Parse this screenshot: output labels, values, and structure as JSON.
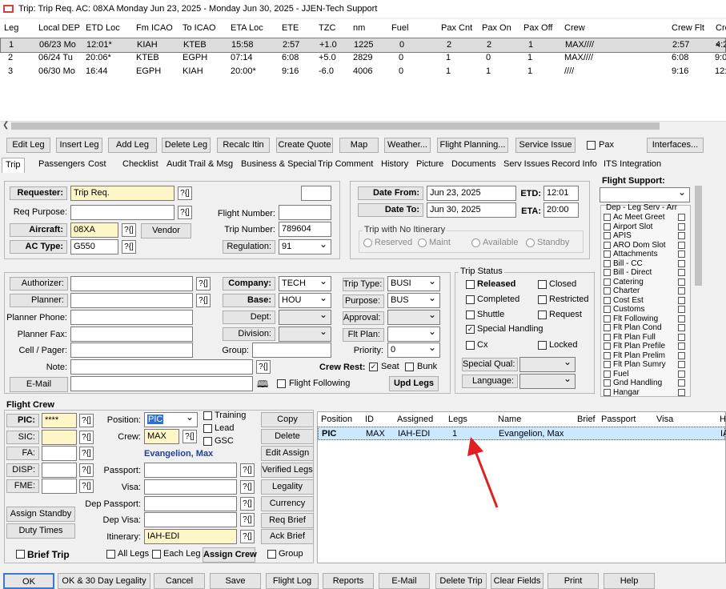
{
  "window": {
    "title": "Trip: Trip Req.  AC: 08XA  Monday Jun 23, 2025 - Monday Jun 30, 2025 - JJEN-Tech Support"
  },
  "legs": {
    "headers": [
      "Leg",
      "Local DEP",
      "ETD Loc",
      "Fm ICAO",
      "To ICAO",
      "ETA Loc",
      "ETE",
      "TZC",
      "nm",
      "Fuel",
      "Pax Cnt",
      "Pax On",
      "Pax Off",
      "Crew",
      "Crew Flt",
      "Cre"
    ],
    "rows": [
      [
        "1",
        "06/23 Mo",
        "12:01*",
        "KIAH",
        "KTEB",
        "15:58",
        "2:57",
        "+1.0",
        "1225",
        "0",
        "2",
        "2",
        "1",
        "MAX////",
        "2:57",
        "4:2"
      ],
      [
        "2",
        "06/24 Tu",
        "20:06*",
        "KTEB",
        "EGPH",
        "07:14",
        "6:08",
        "+5.0",
        "2829",
        "0",
        "1",
        "0",
        "1",
        "MAX////",
        "6:08",
        "9:0"
      ],
      [
        "3",
        "06/30 Mo",
        "16:44",
        "EGPH",
        "KIAH",
        "20:00*",
        "9:16",
        "-6.0",
        "4006",
        "0",
        "1",
        "1",
        "1",
        "////",
        "9:16",
        "12:"
      ]
    ]
  },
  "toolbar": {
    "edit_leg": "Edit Leg",
    "insert_leg": "Insert Leg",
    "add_leg": "Add Leg",
    "delete_leg": "Delete Leg",
    "recalc": "Recalc Itin",
    "create_quote": "Create Quote",
    "map": "Map",
    "weather": "Weather...",
    "flight_planning": "Flight Planning...",
    "service_issue": "Service Issue",
    "pax": "Pax",
    "interfaces": "Interfaces..."
  },
  "tabs": [
    "Trip",
    "Passengers",
    "Cost",
    "Checklist",
    "Audit Trail & Msg",
    "Business & Special",
    "Trip Comment",
    "History",
    "Picture",
    "Documents",
    "Serv Issues",
    "Record Info",
    "ITS Integration"
  ],
  "trip": {
    "requester_label": "Requester:",
    "requester": "Trip Req.",
    "req_purpose_label": "Req Purpose:",
    "req_purpose": "",
    "aircraft_label": "Aircraft:",
    "aircraft": "08XA",
    "vendor": "Vendor",
    "ac_type_label": "AC Type:",
    "ac_type": "G550",
    "flight_number_label": "Flight Number:",
    "flight_number": "",
    "trip_number_label": "Trip Number:",
    "trip_number": "789604",
    "regulation_label": "Regulation:",
    "regulation": "91",
    "q": "?{]"
  },
  "dates": {
    "date_from_label": "Date From:",
    "date_from": "Jun 23, 2025",
    "date_to_label": "Date To:",
    "date_to": "Jun 30, 2025",
    "etd_label": "ETD:",
    "etd": "12:01",
    "eta_label": "ETA:",
    "eta": "20:00",
    "no_itin_title": "Trip with No Itinerary",
    "reserved": "Reserved",
    "maint": "Maint",
    "available": "Available",
    "standby": "Standby"
  },
  "flight_support": {
    "title": "Flight Support:",
    "subtitle": "Dep - Leg Serv - Arr",
    "items": [
      "Ac Meet Greet",
      "Airport Slot",
      "APIS",
      "ARO Dom Slot",
      "Attachments",
      "Bill - CC",
      "Bill - Direct",
      "Catering",
      "Charter",
      "Cost Est",
      "Customs",
      "Flt Following",
      "Flt Plan Cond",
      "Flt Plan Full",
      "Flt Plan Prefile",
      "Flt Plan Prelim",
      "Flt Plan Sumry",
      "Fuel",
      "Gnd Handling",
      "Hangar"
    ]
  },
  "contacts": {
    "authorizer": "Authorizer:",
    "planner": "Planner:",
    "planner_phone": "Planner Phone:",
    "planner_fax": "Planner Fax:",
    "cell_pager": "Cell / Pager:",
    "note": "Note:",
    "email": "E-Mail",
    "company_label": "Company:",
    "company": "TECH",
    "base_label": "Base:",
    "base": "HOU",
    "dept_label": "Dept:",
    "division_label": "Division:",
    "group_label": "Group:",
    "trip_type_label": "Trip Type:",
    "trip_type": "BUSI",
    "purpose_label": "Purpose:",
    "purpose": "BUS",
    "approval_label": "Approval:",
    "flt_plan_label": "Flt Plan:",
    "priority_label": "Priority:",
    "priority": "0",
    "crew_rest": "Crew Rest:",
    "seat": "Seat",
    "bunk": "Bunk",
    "flight_following": "Flight Following",
    "upd_legs": "Upd Legs"
  },
  "trip_status": {
    "title": "Trip Status",
    "released": "Released",
    "closed": "Closed",
    "completed": "Completed",
    "restricted": "Restricted",
    "shuttle": "Shuttle",
    "request": "Request",
    "special_handling": "Special Handling",
    "cx": "Cx",
    "locked": "Locked",
    "special_qual": "Special Qual:",
    "language": "Language:"
  },
  "flight_crew": {
    "title": "Flight Crew",
    "pic": "PIC:",
    "pic_val": "****",
    "sic": "SIC:",
    "fa": "FA:",
    "disp": "DISP:",
    "fme": "FME:",
    "position_label": "Position:",
    "position": "PIC",
    "crew_label": "Crew:",
    "crew": "MAX",
    "crew_name": "Evangelion, Max",
    "training": "Training",
    "lead": "Lead",
    "gsc": "GSC",
    "passport": "Passport:",
    "visa": "Visa:",
    "dep_passport": "Dep Passport:",
    "dep_visa": "Dep Visa:",
    "itinerary_label": "Itinerary:",
    "itinerary": "IAH-EDI",
    "assign_standby": "Assign Standby",
    "duty_times": "Duty Times",
    "brief_trip": "Brief Trip",
    "all_legs": "All Legs",
    "each_leg": "Each Leg",
    "assign_crew": "Assign Crew",
    "group": "Group",
    "copy": "Copy",
    "delete": "Delete",
    "edit_assign": "Edit Assign",
    "verified_legs": "Verified Legs",
    "legality": "Legality",
    "currency": "Currency",
    "req_brief": "Req Brief",
    "ack_brief": "Ack Brief",
    "grid_headers": [
      "Position",
      "ID",
      "Assigned",
      "Legs",
      "Name",
      "Brief",
      "Passport",
      "Visa",
      "H"
    ],
    "grid_row": [
      "PIC",
      "MAX",
      "IAH-EDI",
      "1",
      "Evangelion, Max",
      "",
      "",
      "",
      "IA"
    ]
  },
  "bottom": {
    "ok": "OK",
    "ok30": "OK & 30 Day Legality",
    "cancel": "Cancel",
    "save": "Save",
    "flight_log": "Flight Log",
    "reports": "Reports",
    "email": "E-Mail",
    "delete_trip": "Delete Trip",
    "clear_fields": "Clear Fields",
    "print": "Print",
    "help": "Help"
  },
  "colors": {
    "input_yellow": "#fff6c7",
    "selected_blue": "#cce8ff",
    "annotation_arrow": "#e02020"
  }
}
